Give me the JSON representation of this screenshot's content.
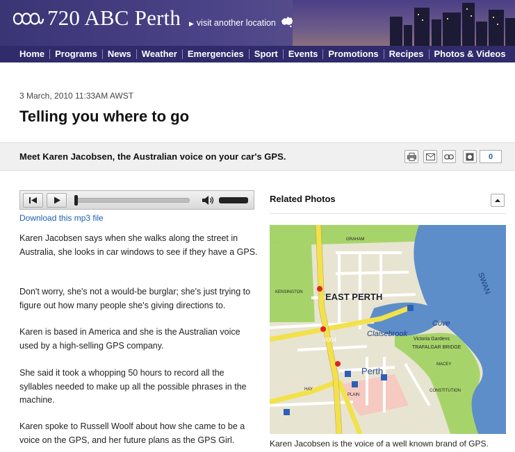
{
  "header": {
    "station_title": "720 ABC Perth",
    "visit_link": "visit another location"
  },
  "nav": {
    "items": [
      "Home",
      "Programs",
      "News",
      "Weather",
      "Emergencies",
      "Sport",
      "Events",
      "Promotions",
      "Recipes",
      "Photos & Videos"
    ]
  },
  "article": {
    "date": "3 March, 2010 11:33AM AWST",
    "headline": "Telling you where to go",
    "summary": "Meet Karen Jacobsen, the Australian voice on your car's GPS.",
    "share_count": "0",
    "download_link": "Download this mp3 file",
    "paragraphs": [
      "Karen Jacobsen says when she walks along the street in Australia, she looks in car windows to see if they have a GPS.",
      "Don't worry, she's not a would-be burglar; she's just trying to figure out how many people she's giving directions to.",
      "Karen is based in America and she is the Australian voice used by a high-selling GPS company.",
      "She said it took a whopping 50 hours to record all the syllables needed to make up all the possible phrases in the machine.",
      "Karen spoke to Russell Woolf about how she came to be a voice on the GPS, and her future plans as the GPS Girl."
    ]
  },
  "player": {
    "progress": 0.0
  },
  "related": {
    "title": "Related Photos",
    "caption": "Karen Jacobsen is the voice of a well known brand of GPS.",
    "map_labels": {
      "east_perth": "EAST PERTH",
      "perth": "Perth",
      "claisebrook": "Claisebrook",
      "cove": "Cove",
      "swan": "SWAN",
      "trafalgar_bridge": "TRAFALGAR BRIDGE",
      "victoria_gardens": "Victoria Gardens",
      "postcode": "6004",
      "graham": "GRAHAM",
      "kensington": "KENSINGTON",
      "hay": "HAY",
      "plain": "PLAIN",
      "macey": "MACEY",
      "constitution": "CONSTITUTION"
    }
  },
  "colors": {
    "nav_bg": "#302b6b",
    "link": "#1f5fb0",
    "map_water": "#5d8ec9",
    "map_park": "#a7d46a",
    "map_road": "#f2e14a"
  }
}
